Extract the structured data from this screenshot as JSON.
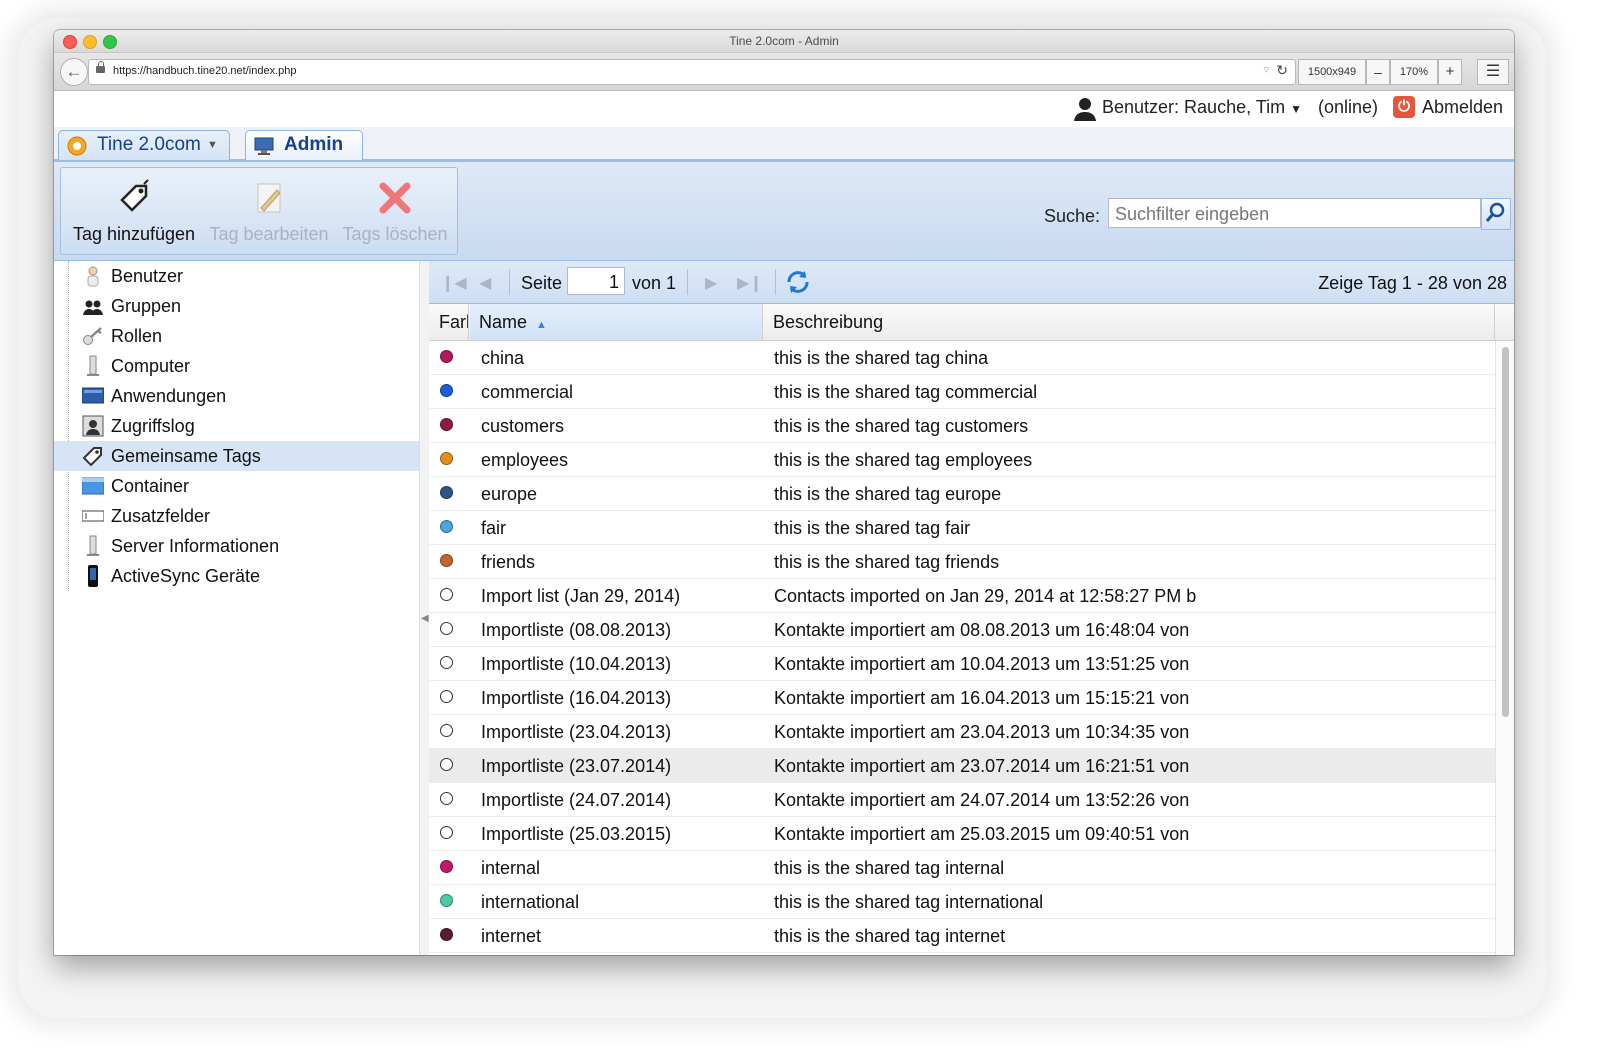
{
  "window": {
    "title": "Tine 2.0com - Admin"
  },
  "browser": {
    "url": "https://handbuch.tine20.net/index.php",
    "dimensions": "1500x949",
    "zoom_out": "–",
    "zoom": "170%",
    "zoom_in": "+"
  },
  "userbar": {
    "user": "Benutzer: Rauche, Tim",
    "status": "(online)",
    "logout": "Abmelden"
  },
  "tabs": [
    {
      "label": "Tine 2.0com"
    },
    {
      "label": "Admin"
    }
  ],
  "toolbar": {
    "add": "Tag hinzufügen",
    "edit": "Tag bearbeiten",
    "delete": "Tags löschen",
    "search_label": "Suche:",
    "search_placeholder": "Suchfilter eingeben"
  },
  "sidebar": {
    "items": [
      {
        "label": "Benutzer",
        "icon": "user-icon"
      },
      {
        "label": "Gruppen",
        "icon": "group-icon"
      },
      {
        "label": "Rollen",
        "icon": "key-icon"
      },
      {
        "label": "Computer",
        "icon": "computer-icon"
      },
      {
        "label": "Anwendungen",
        "icon": "applications-icon"
      },
      {
        "label": "Zugriffslog",
        "icon": "accesslog-icon"
      },
      {
        "label": "Gemeinsame Tags",
        "icon": "tag-icon",
        "selected": true
      },
      {
        "label": "Container",
        "icon": "folder-icon"
      },
      {
        "label": "Zusatzfelder",
        "icon": "field-icon"
      },
      {
        "label": "Server Informationen",
        "icon": "server-icon"
      },
      {
        "label": "ActiveSync Geräte",
        "icon": "phone-icon"
      }
    ]
  },
  "pager": {
    "page_label": "Seite",
    "page_value": "1",
    "of_label": "von 1",
    "summary": "Zeige Tag 1 - 28 von 28"
  },
  "grid": {
    "columns": {
      "color": "Farbe",
      "name": "Name",
      "description": "Beschreibung"
    },
    "rows": [
      {
        "color": "#b3185e",
        "name": "china",
        "description": "this is the shared tag china"
      },
      {
        "color": "#1a5fd6",
        "name": "commercial",
        "description": "this is the shared tag commercial"
      },
      {
        "color": "#8e1a45",
        "name": "customers",
        "description": "this is the shared tag customers"
      },
      {
        "color": "#e0901a",
        "name": "employees",
        "description": "this is the shared tag employees"
      },
      {
        "color": "#2f5486",
        "name": "europe",
        "description": "this is the shared tag europe"
      },
      {
        "color": "#4aa4e0",
        "name": "fair",
        "description": "this is the shared tag fair"
      },
      {
        "color": "#c0662a",
        "name": "friends",
        "description": "this is the shared tag friends"
      },
      {
        "color": "",
        "name": "Import list (Jan 29, 2014)",
        "description": "Contacts imported on Jan 29, 2014 at 12:58:27 PM b"
      },
      {
        "color": "",
        "name": "Importliste (08.08.2013)",
        "description": "Kontakte importiert am 08.08.2013 um 16:48:04 von"
      },
      {
        "color": "",
        "name": "Importliste (10.04.2013)",
        "description": "Kontakte importiert am 10.04.2013 um 13:51:25 von"
      },
      {
        "color": "",
        "name": "Importliste (16.04.2013)",
        "description": "Kontakte importiert am 16.04.2013 um 15:15:21 von"
      },
      {
        "color": "",
        "name": "Importliste (23.04.2013)",
        "description": "Kontakte importiert am 23.04.2013 um 10:34:35 von"
      },
      {
        "color": "",
        "name": "Importliste (23.07.2014)",
        "description": "Kontakte importiert am 23.07.2014 um 16:21:51 von",
        "highlighted": true
      },
      {
        "color": "",
        "name": "Importliste (24.07.2014)",
        "description": "Kontakte importiert am 24.07.2014 um 13:52:26 von"
      },
      {
        "color": "",
        "name": "Importliste (25.03.2015)",
        "description": "Kontakte importiert am 25.03.2015 um 09:40:51 von"
      },
      {
        "color": "#c2186a",
        "name": "internal",
        "description": "this is the shared tag internal"
      },
      {
        "color": "#4cc9a6",
        "name": "international",
        "description": "this is the shared tag international"
      },
      {
        "color": "#5a1d2c",
        "name": "internet",
        "description": "this is the shared tag internet"
      }
    ]
  }
}
